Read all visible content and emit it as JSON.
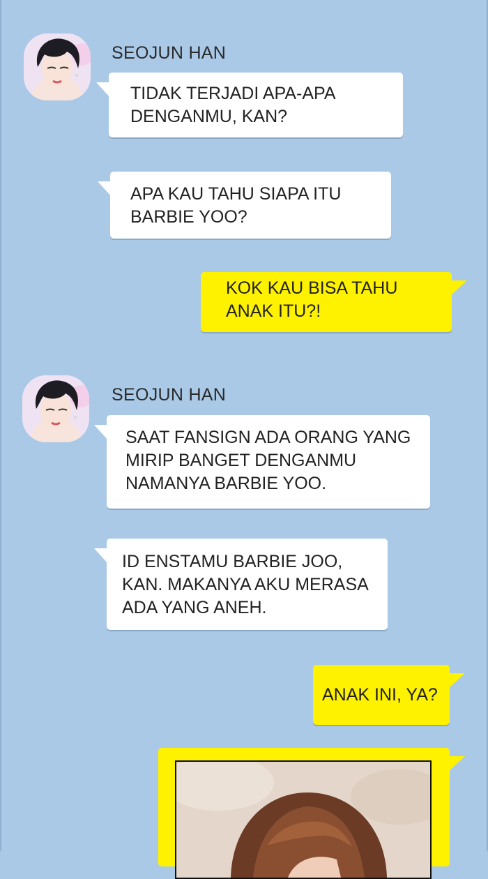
{
  "messages": [
    {
      "sender": "SEOJUN HAN",
      "text": "TIDAK TERJADI APA-APA\nDENGANMU, KAN?"
    },
    {
      "text": "APA KAU TAHU SIAPA ITU\nBARBIE YOO?"
    },
    {
      "text": "KOK KAU BISA TAHU\nANAK ITU?!"
    },
    {
      "sender": "SEOJUN HAN",
      "text": "SAAT FANSIGN ADA ORANG YANG\nMIRIP BANGET DENGANMU\nNAMANYA BARBIE YOO."
    },
    {
      "text": "ID ENSTAMU BARBIE JOO,\nKAN. MAKANYA AKU MERASA\nADA YANG ANEH."
    },
    {
      "text": "ANAK INI, YA?"
    }
  ],
  "colors": {
    "background": "#a9c9e6",
    "incoming_bubble": "#ffffff",
    "outgoing_bubble": "#fff200"
  },
  "icons": {
    "avatar": "profile-photo",
    "photo_attachment": "image-thumbnail"
  }
}
